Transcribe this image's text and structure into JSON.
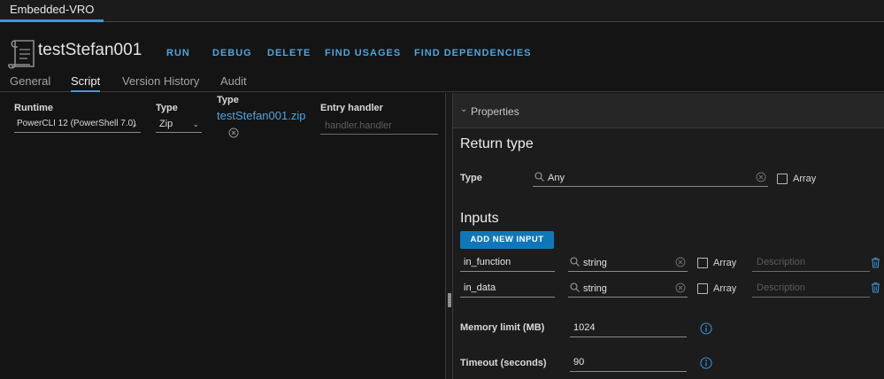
{
  "app": {
    "tab_label": "Embedded-VRO"
  },
  "workflow": {
    "title": "testStefan001"
  },
  "actions": {
    "run": "RUN",
    "debug": "DEBUG",
    "delete": "DELETE",
    "find_usages": "FIND USAGES",
    "find_dependencies": "FIND DEPENDENCIES"
  },
  "tabs": [
    {
      "label": "General",
      "active": false
    },
    {
      "label": "Script",
      "active": true
    },
    {
      "label": "Version History",
      "active": false
    },
    {
      "label": "Audit",
      "active": false
    }
  ],
  "script": {
    "runtime_label": "Runtime",
    "runtime_value": "PowerCLI 12 (PowerShell 7.0)",
    "type_label": "Type",
    "type_value": "Zip",
    "file_type_label": "Type",
    "file_name": "testStefan001.zip",
    "entry_handler_label": "Entry handler",
    "entry_handler_placeholder": "handler.handler"
  },
  "properties": {
    "header": "Properties",
    "return_type": {
      "section_title": "Return type",
      "type_label": "Type",
      "type_value": "Any",
      "array_label": "Array"
    },
    "inputs": {
      "section_title": "Inputs",
      "add_button": "ADD NEW INPUT",
      "rows": [
        {
          "name": "in_function",
          "type": "string",
          "array_label": "Array",
          "description_placeholder": "Description"
        },
        {
          "name": "in_data",
          "type": "string",
          "array_label": "Array",
          "description_placeholder": "Description"
        }
      ]
    },
    "memory_limit": {
      "label": "Memory limit (MB)",
      "value": "1024"
    },
    "timeout": {
      "label": "Timeout (seconds)",
      "value": "90"
    }
  },
  "colors": {
    "accent": "#4fa3e0",
    "button": "#0f77b8",
    "background": "#141414",
    "panel": "#1c1c1c"
  }
}
